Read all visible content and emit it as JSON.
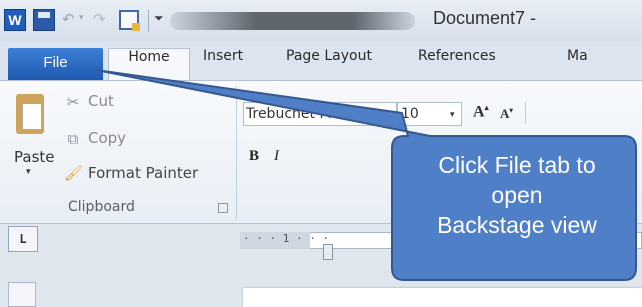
{
  "window": {
    "title": "Document7 -"
  },
  "quick_access": {
    "word_logo": "W"
  },
  "tabs": {
    "file": "File",
    "home": "Home",
    "insert": "Insert",
    "page_layout": "Page Layout",
    "references": "References",
    "mailings_partial": "Ma"
  },
  "clipboard": {
    "paste": "Paste",
    "cut": "Cut",
    "copy": "Copy",
    "format_painter": "Format Painter",
    "group_label": "Clipboard"
  },
  "font": {
    "family": "Trebuchet MS (B",
    "size": "10",
    "grow": "A",
    "shrink": "A",
    "bold": "B",
    "italic": "I"
  },
  "ruler": {
    "tab_selector": "L",
    "marks": "·  ·  ·  1  ·  ·  ·"
  },
  "callout": {
    "line1": "Click File tab to",
    "line2": "open",
    "line3": "Backstage view",
    "fill_color": "#4f7fc6",
    "border_color": "#35598f"
  }
}
